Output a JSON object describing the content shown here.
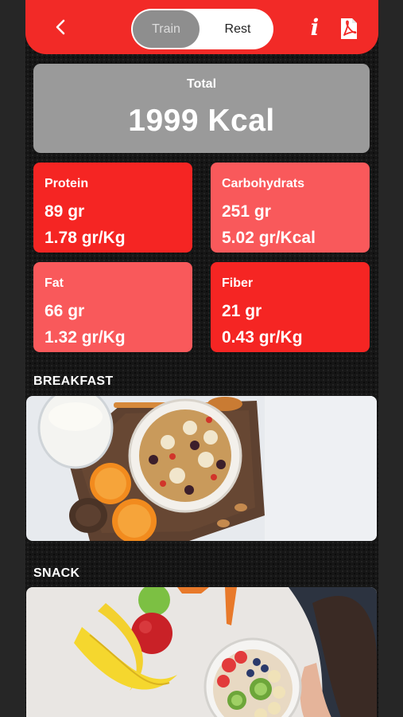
{
  "header": {
    "toggle": {
      "train_label": "Train",
      "rest_label": "Rest",
      "selected": "Train"
    },
    "info_icon": "info-icon",
    "pdf_icon": "pdf-icon",
    "back_icon": "chevron-left-icon"
  },
  "total": {
    "label": "Total",
    "value": "1999 Kcal"
  },
  "macros": [
    {
      "name": "Protein",
      "amount": "89 gr",
      "ratio": "1.78 gr/Kg"
    },
    {
      "name": "Carbohydrats",
      "amount": "251 gr",
      "ratio": "5.02 gr/Kcal"
    },
    {
      "name": "Fat",
      "amount": "66 gr",
      "ratio": "1.32 gr/Kg"
    },
    {
      "name": "Fiber",
      "amount": "21 gr",
      "ratio": "0.43 gr/Kg"
    }
  ],
  "meals": [
    {
      "title": "BREAKFAST"
    },
    {
      "title": "SNACK"
    }
  ],
  "colors": {
    "header_red": "#f22a27",
    "card_dark_red": "#f52523",
    "card_light_red": "#f9595b",
    "total_gray": "#9a9a9a"
  }
}
